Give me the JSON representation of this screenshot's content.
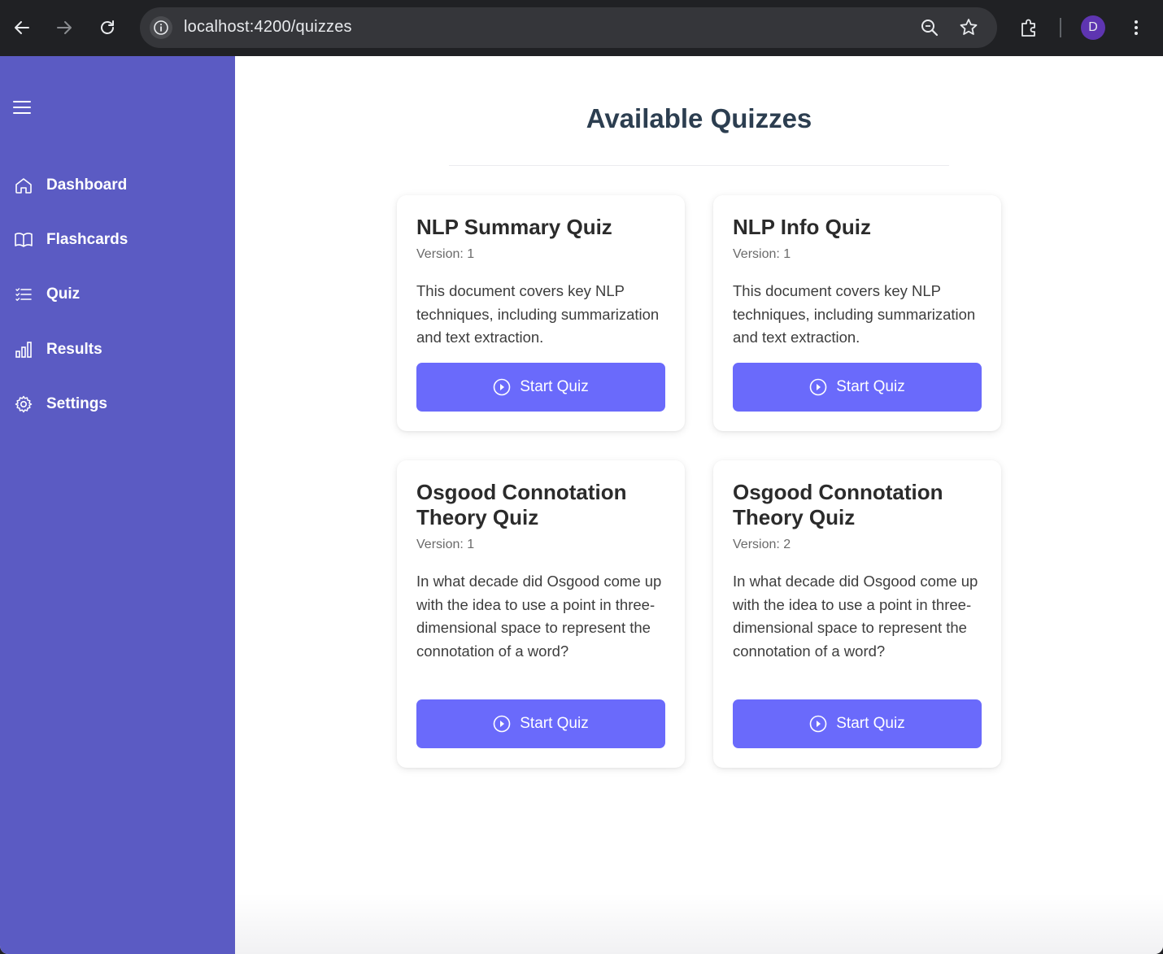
{
  "browser": {
    "url": "localhost:4200/quizzes",
    "profile_initial": "D"
  },
  "sidebar": {
    "items": [
      {
        "label": "Dashboard",
        "icon": "home-icon"
      },
      {
        "label": "Flashcards",
        "icon": "book-icon"
      },
      {
        "label": "Quiz",
        "icon": "list-icon"
      },
      {
        "label": "Results",
        "icon": "bar-chart-icon"
      },
      {
        "label": "Settings",
        "icon": "gear-icon"
      }
    ]
  },
  "main": {
    "title": "Available Quizzes",
    "quizzes": [
      {
        "title": "NLP Summary Quiz",
        "version": "Version: 1",
        "description": "This document covers key NLP techniques, including summarization and text extraction.",
        "button": "Start Quiz"
      },
      {
        "title": "NLP Info Quiz",
        "version": "Version: 1",
        "description": "This document covers key NLP techniques, including summarization and text extraction.",
        "button": "Start Quiz"
      },
      {
        "title": "Osgood Connotation Theory Quiz",
        "version": "Version: 1",
        "description": "In what decade did Osgood come up with the idea to use a point in three-dimensional space to represent the connotation of a word?",
        "button": "Start Quiz"
      },
      {
        "title": "Osgood Connotation Theory Quiz",
        "version": "Version: 2",
        "description": "In what decade did Osgood come up with the idea to use a point in three-dimensional space to represent the connotation of a word?",
        "button": "Start Quiz"
      }
    ]
  },
  "colors": {
    "sidebar": "#5b5bc3",
    "button": "#6a6afb",
    "title": "#2c3e50"
  }
}
